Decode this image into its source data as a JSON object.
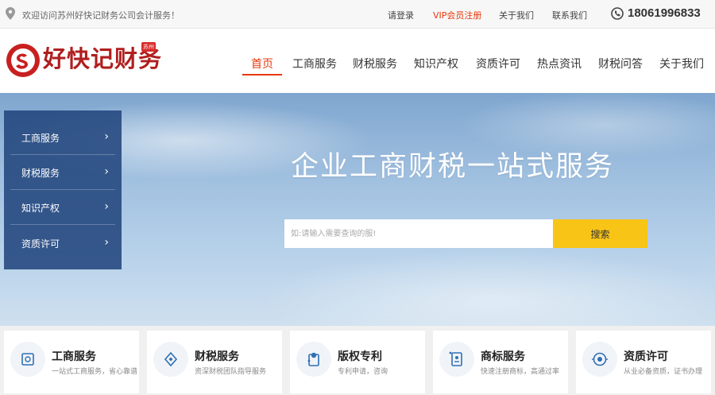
{
  "topbar": {
    "welcome": "欢迎访问苏州好快记财务公司会计服务！",
    "links": [
      "请登录",
      "VIP会员注册",
      "关于我们",
      "联系我们"
    ],
    "phone": "18061996833"
  },
  "header": {
    "logo_text": "好快记财务",
    "logo_badge": "苏州",
    "nav": [
      "首页",
      "工商服务",
      "财税服务",
      "知识产权",
      "资质许可",
      "热点资讯",
      "财税问答",
      "关于我们"
    ],
    "active_nav": "首页"
  },
  "sidebar": {
    "items": [
      {
        "label": "工商服务",
        "arrow": "›"
      },
      {
        "label": "财税服务",
        "arrow": "›"
      },
      {
        "label": "知识产权",
        "arrow": "›"
      },
      {
        "label": "资质许可",
        "arrow": "›"
      }
    ]
  },
  "banner": {
    "title": "企业工商财税一站式服务",
    "search_placeholder": "如:请输入需要查询的服!",
    "search_button": "搜索"
  },
  "services": [
    {
      "title": "工商服务",
      "desc": "一站式工商服务，省心靠谱",
      "icon": "building-icon"
    },
    {
      "title": "财税服务",
      "desc": "资深财税团队指导服务",
      "icon": "tax-icon"
    },
    {
      "title": "版权专利",
      "desc": "专利申请，咨询",
      "icon": "patent-icon"
    },
    {
      "title": "商标服务",
      "desc": "快速注册商标，高通过率",
      "icon": "trademark-icon"
    },
    {
      "title": "资质许可",
      "desc": "从业必备资质，证书办理",
      "icon": "license-icon"
    }
  ],
  "colors": {
    "accent": "#e8380d",
    "brand_red": "#b01f1f",
    "search_button": "#f8c416",
    "sidebar_bg": "#22467d"
  }
}
